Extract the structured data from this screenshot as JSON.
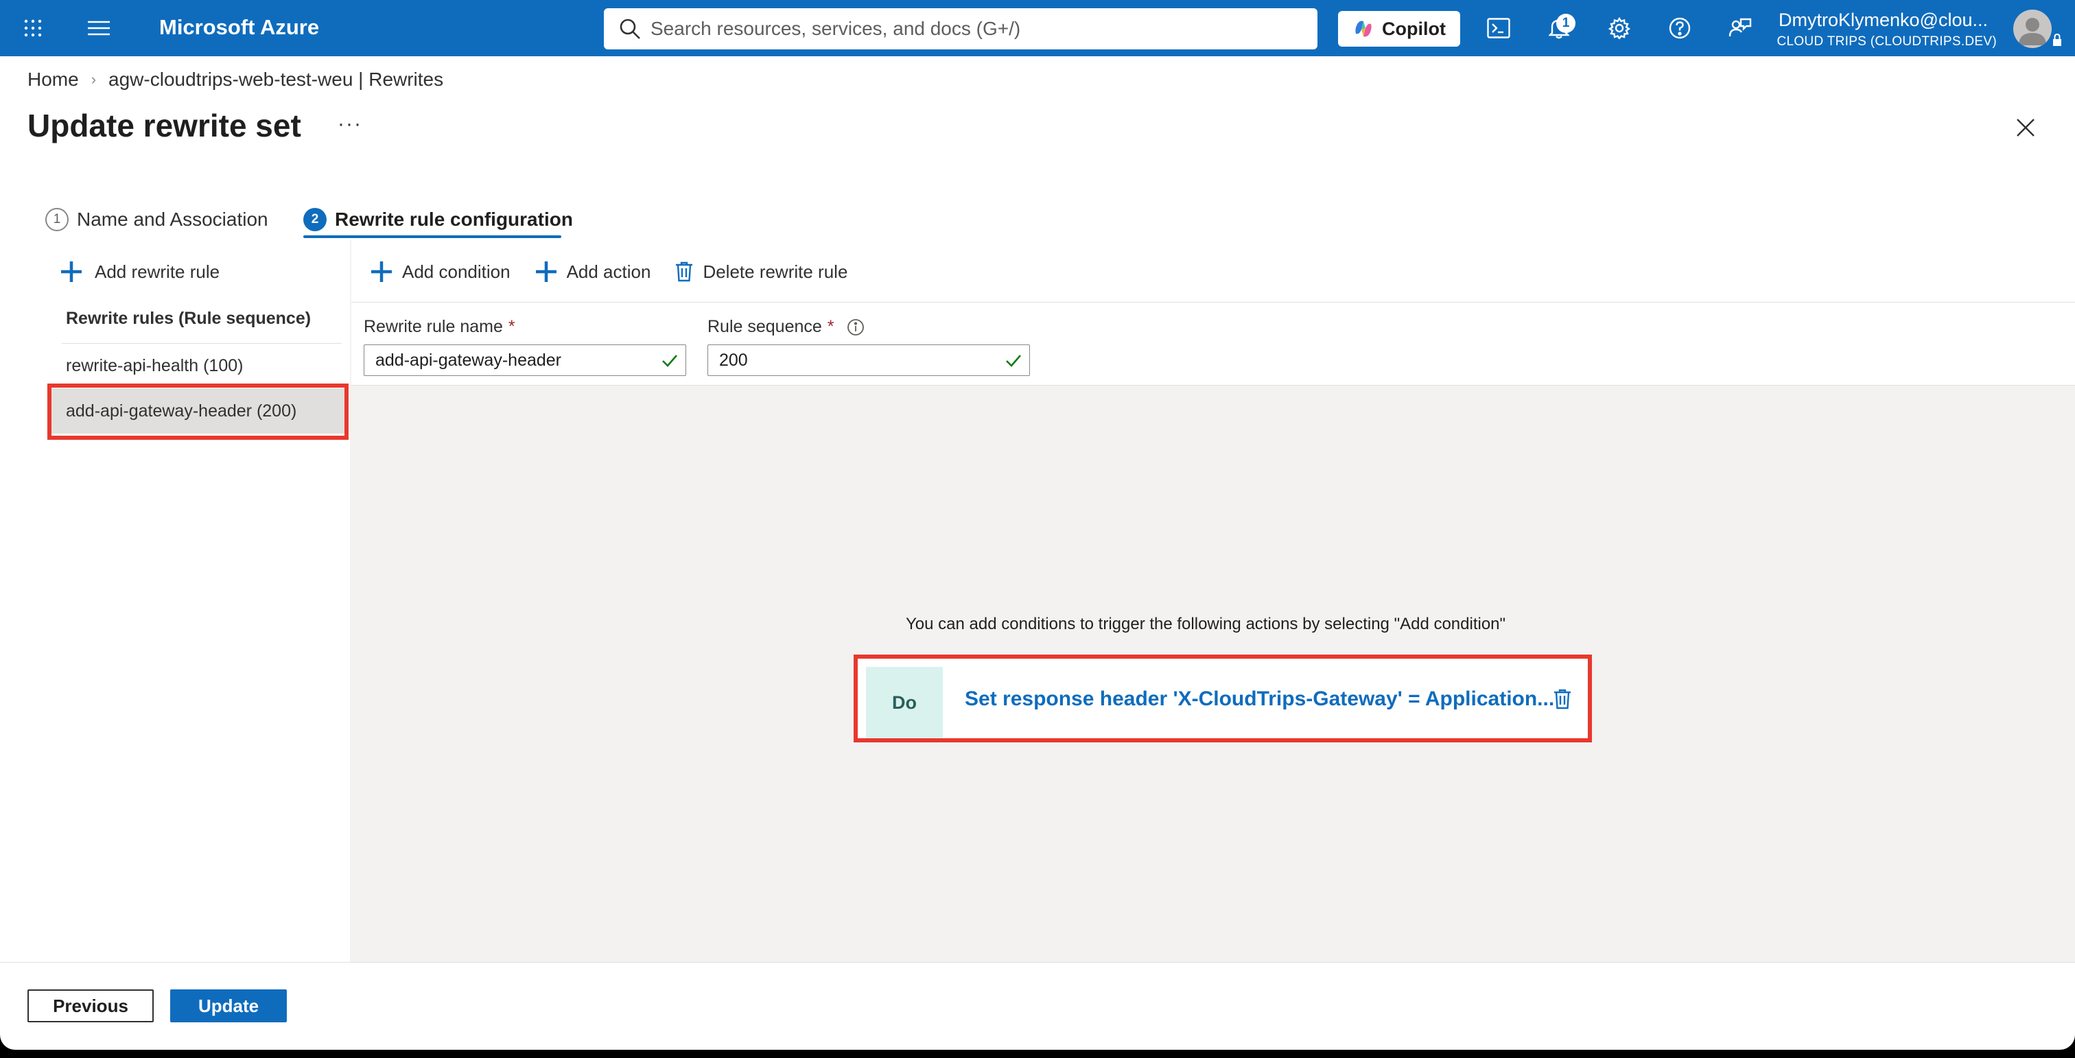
{
  "topbar": {
    "brand": "Microsoft Azure",
    "search_placeholder": "Search resources, services, and docs (G+/)",
    "copilot_label": "Copilot",
    "notification_count": "1",
    "account_name": "DmytroKlymenko@clou...",
    "account_directory": "CLOUD TRIPS (CLOUDTRIPS.DEV)",
    "icons": [
      "portal-menu-icon",
      "hamburger-icon",
      "search-icon",
      "copilot-icon",
      "cloud-shell-icon",
      "bell-icon",
      "gear-icon",
      "help-icon",
      "feedback-icon",
      "avatar"
    ],
    "accent": "#0f6cbd"
  },
  "breadcrumb": {
    "home": "Home",
    "separator": "›",
    "resource": "agw-cloudtrips-web-test-weu | Rewrites"
  },
  "page": {
    "title": "Update rewrite set",
    "more": "···"
  },
  "tabs": [
    {
      "number": "1",
      "label": "Name and Association"
    },
    {
      "number": "2",
      "label": "Rewrite rule configuration"
    }
  ],
  "rules_panel": {
    "add_label": "Add rewrite rule",
    "header": "Rewrite rules (Rule sequence)",
    "items": [
      {
        "label": "rewrite-api-health (100)"
      },
      {
        "label": "add-api-gateway-header (200)"
      }
    ],
    "selected_index": 1
  },
  "toolbar": {
    "add_condition": "Add condition",
    "add_action": "Add action",
    "delete_rule": "Delete rewrite rule"
  },
  "form": {
    "name_label": "Rewrite rule name",
    "name_value": "add-api-gateway-header",
    "sequence_label": "Rule sequence",
    "sequence_value": "200",
    "required_mark": "*"
  },
  "canvas": {
    "hint": "You can add conditions to trigger the following actions by selecting \"Add condition\"",
    "action_tag": "Do",
    "action_text": "Set response header 'X-CloudTrips-Gateway' = Application..."
  },
  "footer": {
    "previous": "Previous",
    "update": "Update"
  },
  "colors": {
    "highlight": "#e8382e",
    "do_tag_bg": "#d9f2ee"
  }
}
